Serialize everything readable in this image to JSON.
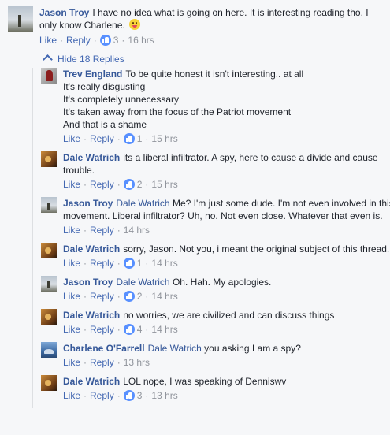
{
  "top_comment": {
    "author": "Jason Troy",
    "text": "I have no idea what is going on here. It is interesting reading tho. I only know Charlene.",
    "like_label": "Like",
    "reply_label": "Reply",
    "like_count": "3",
    "time": "16 hrs"
  },
  "hide_replies_label": "Hide 18 Replies",
  "replies": [
    {
      "author": "Trev England",
      "lines": [
        "To be quite honest it isn't interesting.. at all",
        "It's really disgusting",
        "It's completely unnecessary",
        "It's taken away from the focus of the Patriot movement",
        "And that is a shame"
      ],
      "like_label": "Like",
      "reply_label": "Reply",
      "like_count": "1",
      "time": "15 hrs"
    },
    {
      "author": "Dale Watrich",
      "text": "its a liberal infiltrator. A spy, here to cause a divide and cause trouble.",
      "like_label": "Like",
      "reply_label": "Reply",
      "like_count": "2",
      "time": "15 hrs"
    },
    {
      "author": "Jason Troy",
      "mention": "Dale Watrich",
      "text": "Me? I'm just some dude. I'm not even involved in this movement. Liberal infiltrator? Uh, no. Not even close. Whatever that even is.",
      "like_label": "Like",
      "reply_label": "Reply",
      "time": "14 hrs"
    },
    {
      "author": "Dale Watrich",
      "text": "sorry, Jason. Not you, i meant the original subject of this thread.",
      "like_label": "Like",
      "reply_label": "Reply",
      "like_count": "1",
      "time": "14 hrs"
    },
    {
      "author": "Jason Troy",
      "mention": "Dale Watrich",
      "text": "Oh. Hah. My apologies.",
      "like_label": "Like",
      "reply_label": "Reply",
      "like_count": "2",
      "time": "14 hrs"
    },
    {
      "author": "Dale Watrich",
      "text": "no worries, we are civilized and can discuss things",
      "like_label": "Like",
      "reply_label": "Reply",
      "like_count": "4",
      "time": "14 hrs"
    },
    {
      "author": "Charlene O'Farrell",
      "mention": "Dale Watrich",
      "text": "you asking I am a spy?",
      "like_label": "Like",
      "reply_label": "Reply",
      "time": "13 hrs"
    },
    {
      "author": "Dale Watrich",
      "text": "LOL nope, I was speaking of Denniswv",
      "like_label": "Like",
      "reply_label": "Reply",
      "like_count": "3",
      "time": "13 hrs"
    }
  ]
}
